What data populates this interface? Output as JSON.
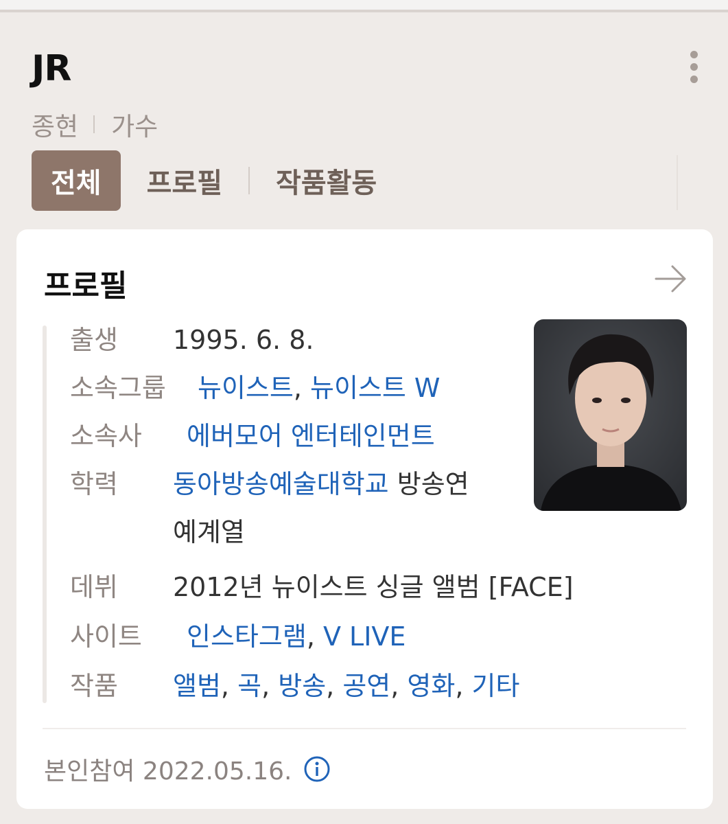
{
  "header": {
    "title": "JR",
    "subtitle_name": "종현",
    "subtitle_job": "가수",
    "more_icon": "more-vertical-icon"
  },
  "tabs": [
    {
      "label": "전체",
      "active": true
    },
    {
      "label": "프로필",
      "active": false
    },
    {
      "label": "작품활동",
      "active": false
    }
  ],
  "profile": {
    "title": "프로필",
    "arrow_icon": "arrow-right-icon",
    "rows": {
      "birth": {
        "label": "출생",
        "value": "1995. 6. 8."
      },
      "group": {
        "label": "소속그룹",
        "link1": "뉴이스트",
        "sep": ", ",
        "link2": "뉴이스트 W"
      },
      "agency": {
        "label": "소속사",
        "link": "에버모어 엔터테인먼트"
      },
      "education": {
        "label": "학력",
        "link": "동아방송예술대학교",
        "rest1": " 방송연",
        "rest2": "예계열"
      },
      "debut": {
        "label": "데뷔",
        "value": "2012년 뉴이스트 싱글 앨범 [FACE]"
      },
      "site": {
        "label": "사이트",
        "link1": "인스타그램",
        "sep": ", ",
        "link2": "V LIVE"
      },
      "works": {
        "label": "작품",
        "items": [
          "앨범",
          "곡",
          "방송",
          "공연",
          "영화",
          "기타"
        ],
        "sep": ", "
      }
    },
    "footer": "본인참여 2022.05.16.",
    "info_icon": "info-icon"
  },
  "colors": {
    "accent": "#8e766a",
    "link": "#1f63b8",
    "background": "#efebe8"
  }
}
